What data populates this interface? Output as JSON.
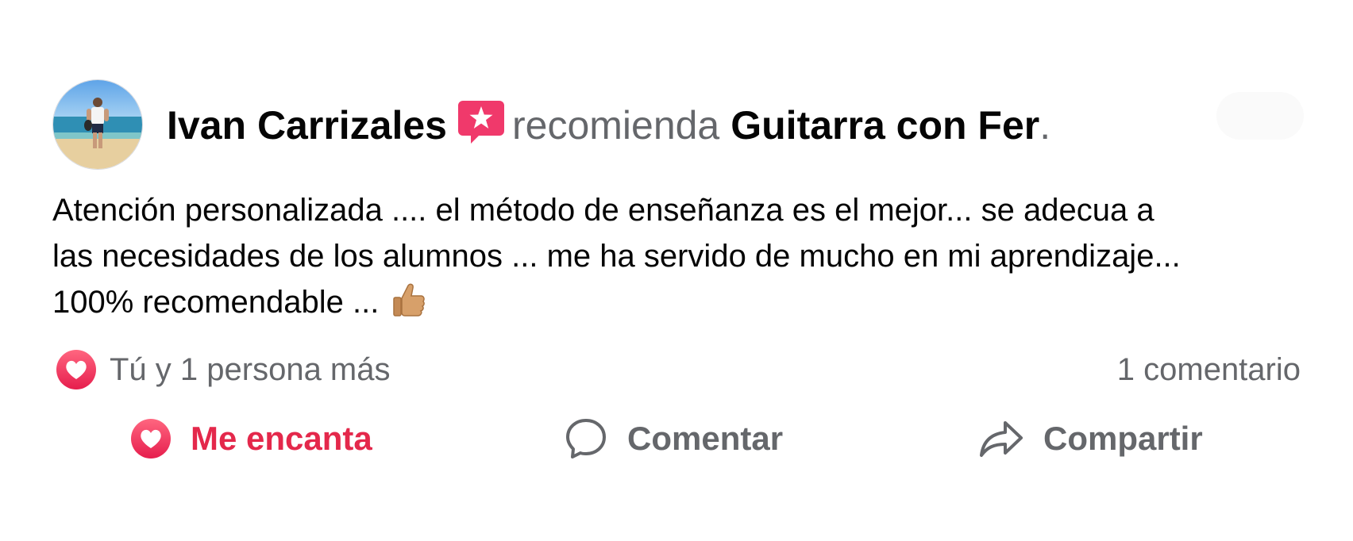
{
  "post": {
    "author": "Ivan Carrizales",
    "recommend_verb": "recomienda",
    "page_name": "Guitarra con Fer",
    "period": ".",
    "review_lines": [
      "Atención personalizada .... el método de enseñanza es el mejor... se adecua a",
      "las necesidades de los alumnos ... me ha servido de mucho en mi aprendizaje...",
      "100% recomendable ... "
    ]
  },
  "engagement": {
    "reaction_summary": "Tú y 1 persona más",
    "comment_count": "1 comentario",
    "reaction_icon": "heart-reaction-icon"
  },
  "actions": {
    "love_label": "Me encanta",
    "comment_label": "Comentar",
    "share_label": "Compartir"
  },
  "colors": {
    "love_red": "#e4284b",
    "recommend_pink": "#f0396b",
    "muted_text": "#65676b",
    "primary_text": "#050505"
  }
}
